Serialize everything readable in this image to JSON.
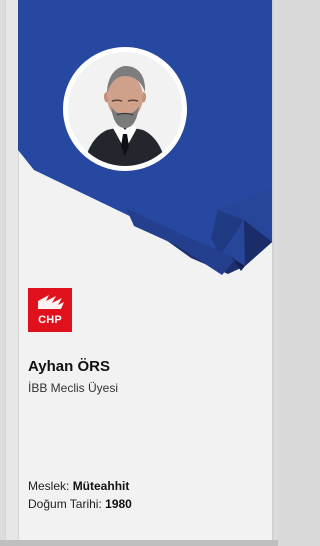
{
  "profile": {
    "name": "Ayhan ÖRS",
    "role": "İBB Meclis Üyesi",
    "profession_label": "Meslek: ",
    "profession_value": "Müteahhit",
    "birth_label": "Doğum Tarihi: ",
    "birth_value": "1980"
  },
  "logo": {
    "text": "CHP",
    "color": "#e0111c"
  },
  "colors": {
    "banner_blue": "#2648a0",
    "banner_dark": "#1f3478",
    "background": "#f2f2f2"
  },
  "icons": {
    "avatar": "portrait-photo",
    "logo_mark": "party-logo-icon"
  }
}
